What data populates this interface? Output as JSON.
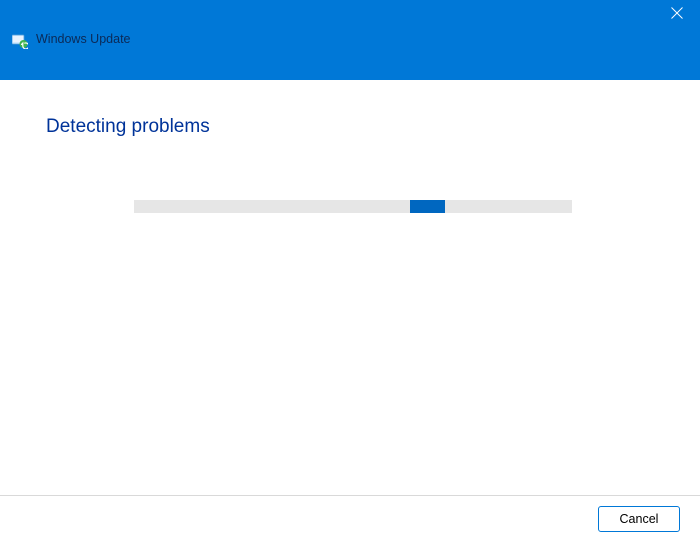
{
  "titlebar": {
    "close_icon_name": "close"
  },
  "header": {
    "title": "Windows Update",
    "icon_name": "windows-update"
  },
  "main": {
    "heading": "Detecting problems",
    "progress": {
      "segment_left_percent": 63,
      "segment_width_percent": 8
    }
  },
  "footer": {
    "cancel_label": "Cancel"
  }
}
